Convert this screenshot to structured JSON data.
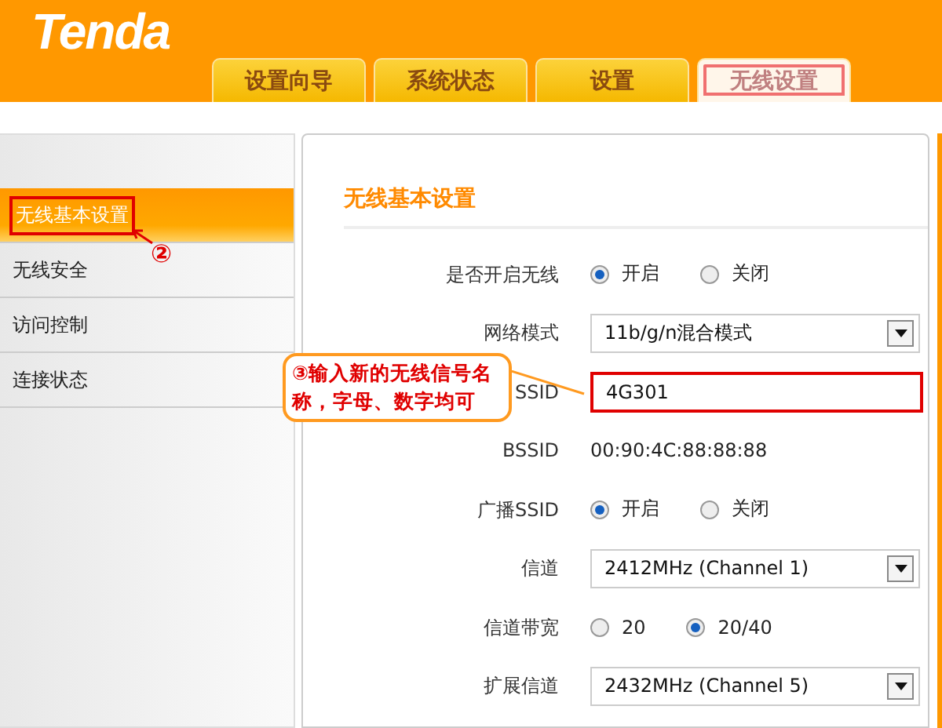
{
  "logo": "Tenda",
  "tabs": [
    {
      "label": "设置向导",
      "selected": false,
      "highlighted": false
    },
    {
      "label": "系统状态",
      "selected": false,
      "highlighted": false
    },
    {
      "label": "设置",
      "selected": false,
      "highlighted": false
    },
    {
      "label": "无线设置",
      "selected": true,
      "highlighted": true
    }
  ],
  "sidebar": {
    "items": [
      {
        "label": "无线基本设置",
        "selected": true,
        "highlighted": true,
        "marker": "②"
      },
      {
        "label": "无线安全",
        "selected": false,
        "highlighted": false
      },
      {
        "label": "访问控制",
        "selected": false,
        "highlighted": false
      },
      {
        "label": "连接状态",
        "selected": false,
        "highlighted": false
      }
    ]
  },
  "main": {
    "title": "无线基本设置",
    "fields": [
      {
        "kind": "radio",
        "label": "是否开启无线",
        "options": [
          {
            "label": "开启",
            "selected": true
          },
          {
            "label": "关闭",
            "selected": false
          }
        ]
      },
      {
        "kind": "select",
        "label": "网络模式",
        "value": "11b/g/n混合模式"
      },
      {
        "kind": "text",
        "label": "SSID",
        "value": "4G301",
        "highlighted": true
      },
      {
        "kind": "static",
        "label": "BSSID",
        "value": "00:90:4C:88:88:88"
      },
      {
        "kind": "radio",
        "label": "广播SSID",
        "options": [
          {
            "label": "开启",
            "selected": true
          },
          {
            "label": "关闭",
            "selected": false
          }
        ]
      },
      {
        "kind": "select",
        "label": "信道",
        "value": "2412MHz (Channel 1)"
      },
      {
        "kind": "radio",
        "label": "信道带宽",
        "options": [
          {
            "label": "20",
            "selected": false
          },
          {
            "label": "20/40",
            "selected": true
          }
        ]
      },
      {
        "kind": "select",
        "label": "扩展信道",
        "value": "2432MHz (Channel 5)"
      }
    ]
  },
  "callout": {
    "marker": "③",
    "text": "输入新的无线信号名称，字母、数字均可"
  }
}
